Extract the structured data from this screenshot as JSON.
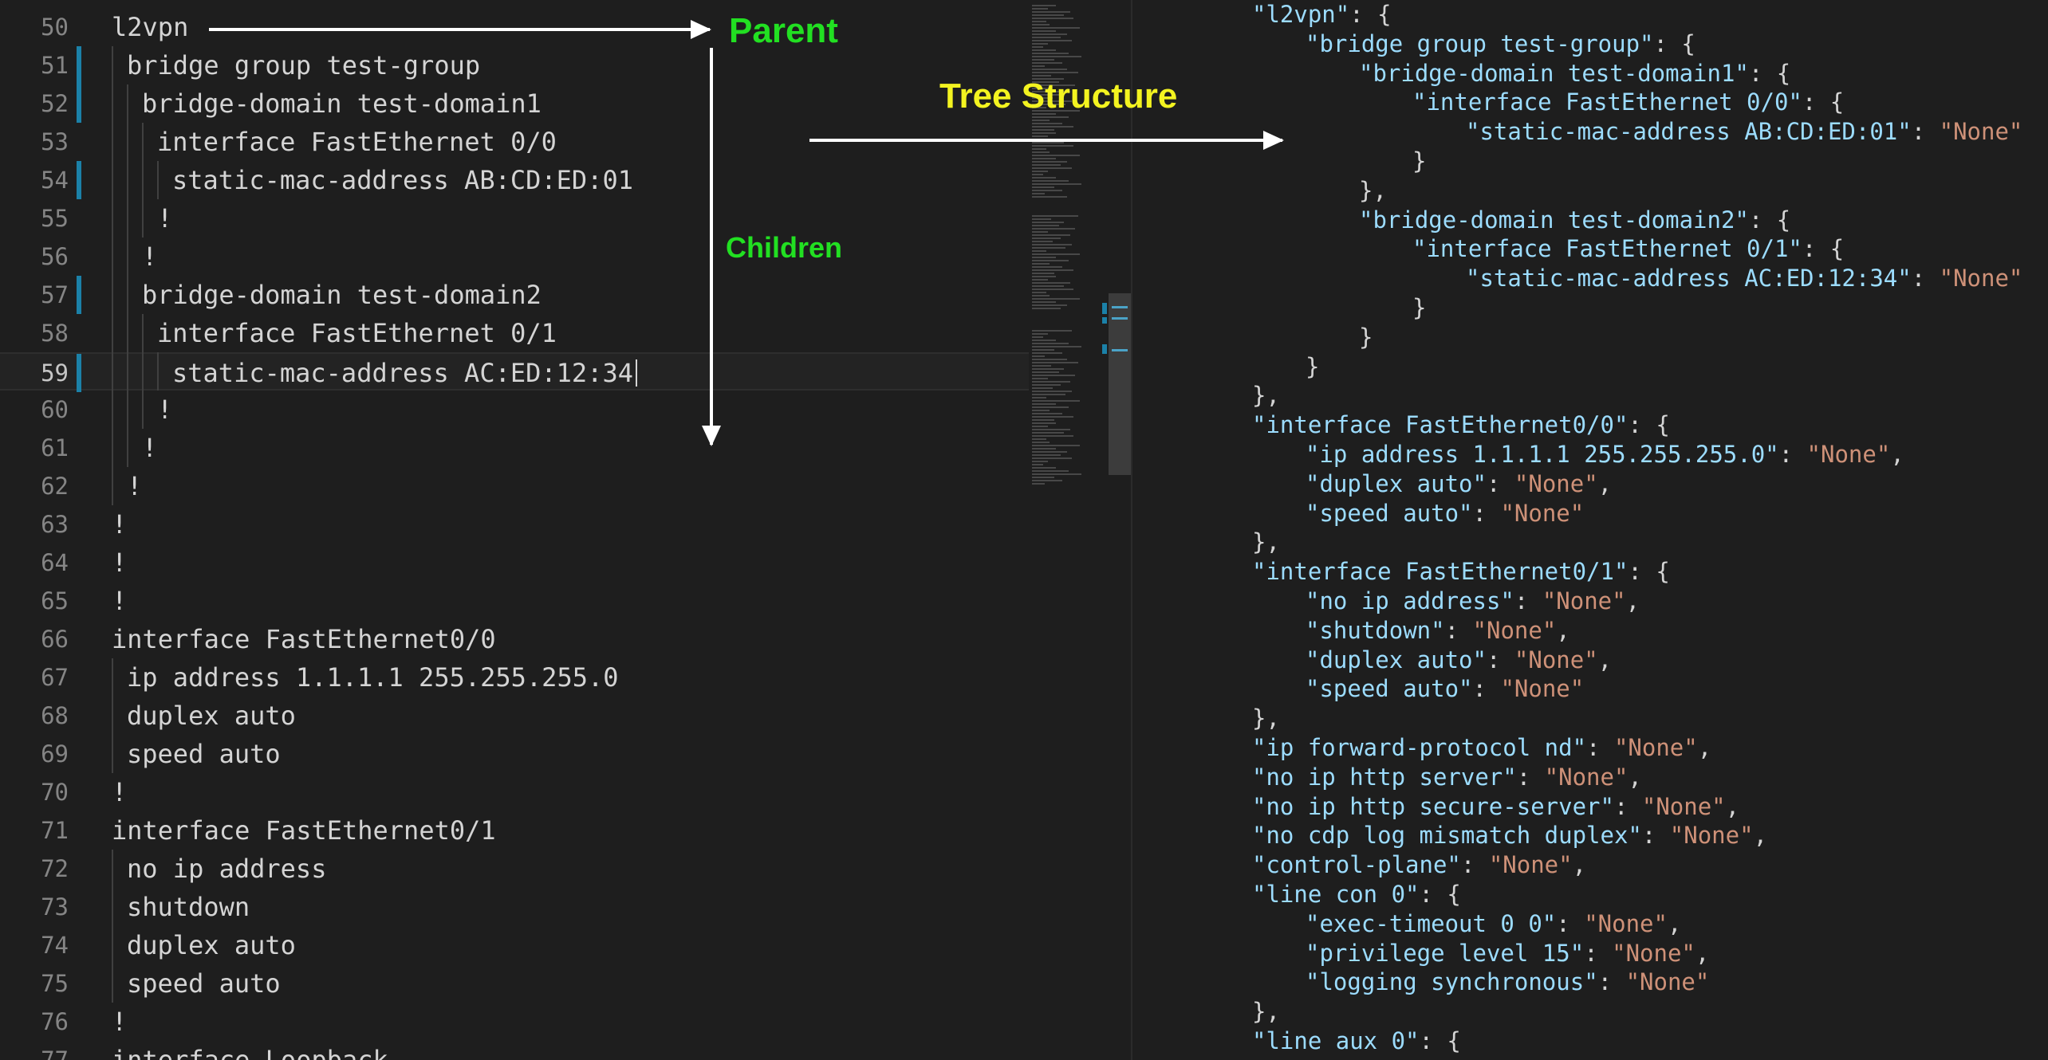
{
  "editor": {
    "lines": [
      {
        "num": "50",
        "text": "l2vpn",
        "indent": 0,
        "mark": false
      },
      {
        "num": "51",
        "text": "bridge group test-group",
        "indent": 1,
        "mark": true
      },
      {
        "num": "52",
        "text": "bridge-domain test-domain1",
        "indent": 2,
        "mark": true
      },
      {
        "num": "53",
        "text": "interface FastEthernet 0/0",
        "indent": 3,
        "mark": false
      },
      {
        "num": "54",
        "text": "static-mac-address AB:CD:ED:01",
        "indent": 4,
        "mark": true
      },
      {
        "num": "55",
        "text": "!",
        "indent": 3,
        "mark": false
      },
      {
        "num": "56",
        "text": "!",
        "indent": 2,
        "mark": false
      },
      {
        "num": "57",
        "text": "bridge-domain test-domain2",
        "indent": 2,
        "mark": true
      },
      {
        "num": "58",
        "text": "interface FastEthernet 0/1",
        "indent": 3,
        "mark": false
      },
      {
        "num": "59",
        "text": "static-mac-address AC:ED:12:34",
        "indent": 4,
        "mark": true,
        "current": true
      },
      {
        "num": "60",
        "text": "!",
        "indent": 3,
        "mark": false
      },
      {
        "num": "61",
        "text": "!",
        "indent": 2,
        "mark": false
      },
      {
        "num": "62",
        "text": "!",
        "indent": 1,
        "mark": false
      },
      {
        "num": "63",
        "text": "!",
        "indent": 0,
        "mark": false
      },
      {
        "num": "64",
        "text": "!",
        "indent": 0,
        "mark": false
      },
      {
        "num": "65",
        "text": "!",
        "indent": 0,
        "mark": false
      },
      {
        "num": "66",
        "text": "interface FastEthernet0/0",
        "indent": 0,
        "mark": false
      },
      {
        "num": "67",
        "text": "ip address 1.1.1.1 255.255.255.0",
        "indent": 1,
        "mark": false
      },
      {
        "num": "68",
        "text": "duplex auto",
        "indent": 1,
        "mark": false
      },
      {
        "num": "69",
        "text": "speed auto",
        "indent": 1,
        "mark": false
      },
      {
        "num": "70",
        "text": "!",
        "indent": 0,
        "mark": false
      },
      {
        "num": "71",
        "text": "interface FastEthernet0/1",
        "indent": 0,
        "mark": false
      },
      {
        "num": "72",
        "text": "no ip address",
        "indent": 1,
        "mark": false
      },
      {
        "num": "73",
        "text": "shutdown",
        "indent": 1,
        "mark": false
      },
      {
        "num": "74",
        "text": "duplex auto",
        "indent": 1,
        "mark": false
      },
      {
        "num": "75",
        "text": "speed auto",
        "indent": 1,
        "mark": false
      },
      {
        "num": "76",
        "text": "!",
        "indent": 0,
        "mark": false
      },
      {
        "num": "77",
        "text": "interface Loopback",
        "indent": 0,
        "mark": false
      }
    ]
  },
  "annotations": {
    "parent": "Parent",
    "children": "Children",
    "tree_structure": "Tree Structure",
    "color_green": "#22e022",
    "color_yellow": "#f3f320",
    "color_arrow": "#ffffff"
  },
  "json_view": {
    "lines": [
      {
        "indent": 0,
        "tokens": [
          [
            "k",
            "\"l2vpn\""
          ],
          [
            "p",
            ": {"
          ]
        ]
      },
      {
        "indent": 1,
        "tokens": [
          [
            "k",
            "\"bridge group test-group\""
          ],
          [
            "p",
            ": {"
          ]
        ]
      },
      {
        "indent": 2,
        "tokens": [
          [
            "k",
            "\"bridge-domain test-domain1\""
          ],
          [
            "p",
            ": {"
          ]
        ]
      },
      {
        "indent": 3,
        "tokens": [
          [
            "k",
            "\"interface FastEthernet 0/0\""
          ],
          [
            "p",
            ": {"
          ]
        ]
      },
      {
        "indent": 4,
        "tokens": [
          [
            "k",
            "\"static-mac-address AB:CD:ED:01\""
          ],
          [
            "p",
            ": "
          ],
          [
            "s",
            "\"None\""
          ]
        ]
      },
      {
        "indent": 3,
        "tokens": [
          [
            "p",
            "}"
          ]
        ]
      },
      {
        "indent": 2,
        "tokens": [
          [
            "p",
            "},"
          ]
        ]
      },
      {
        "indent": 2,
        "tokens": [
          [
            "k",
            "\"bridge-domain test-domain2\""
          ],
          [
            "p",
            ": {"
          ]
        ]
      },
      {
        "indent": 3,
        "tokens": [
          [
            "k",
            "\"interface FastEthernet 0/1\""
          ],
          [
            "p",
            ": {"
          ]
        ]
      },
      {
        "indent": 4,
        "tokens": [
          [
            "k",
            "\"static-mac-address AC:ED:12:34\""
          ],
          [
            "p",
            ": "
          ],
          [
            "s",
            "\"None\""
          ]
        ]
      },
      {
        "indent": 3,
        "tokens": [
          [
            "p",
            "}"
          ]
        ]
      },
      {
        "indent": 2,
        "tokens": [
          [
            "p",
            "}"
          ]
        ]
      },
      {
        "indent": 1,
        "tokens": [
          [
            "p",
            "}"
          ]
        ]
      },
      {
        "indent": 0,
        "tokens": [
          [
            "p",
            "},"
          ]
        ]
      },
      {
        "indent": 0,
        "tokens": [
          [
            "k",
            "\"interface FastEthernet0/0\""
          ],
          [
            "p",
            ": {"
          ]
        ]
      },
      {
        "indent": 1,
        "tokens": [
          [
            "k",
            "\"ip address 1.1.1.1 255.255.255.0\""
          ],
          [
            "p",
            ": "
          ],
          [
            "s",
            "\"None\""
          ],
          [
            "p",
            ","
          ]
        ]
      },
      {
        "indent": 1,
        "tokens": [
          [
            "k",
            "\"duplex auto\""
          ],
          [
            "p",
            ": "
          ],
          [
            "s",
            "\"None\""
          ],
          [
            "p",
            ","
          ]
        ]
      },
      {
        "indent": 1,
        "tokens": [
          [
            "k",
            "\"speed auto\""
          ],
          [
            "p",
            ": "
          ],
          [
            "s",
            "\"None\""
          ]
        ]
      },
      {
        "indent": 0,
        "tokens": [
          [
            "p",
            "},"
          ]
        ]
      },
      {
        "indent": 0,
        "tokens": [
          [
            "k",
            "\"interface FastEthernet0/1\""
          ],
          [
            "p",
            ": {"
          ]
        ]
      },
      {
        "indent": 1,
        "tokens": [
          [
            "k",
            "\"no ip address\""
          ],
          [
            "p",
            ": "
          ],
          [
            "s",
            "\"None\""
          ],
          [
            "p",
            ","
          ]
        ]
      },
      {
        "indent": 1,
        "tokens": [
          [
            "k",
            "\"shutdown\""
          ],
          [
            "p",
            ": "
          ],
          [
            "s",
            "\"None\""
          ],
          [
            "p",
            ","
          ]
        ]
      },
      {
        "indent": 1,
        "tokens": [
          [
            "k",
            "\"duplex auto\""
          ],
          [
            "p",
            ": "
          ],
          [
            "s",
            "\"None\""
          ],
          [
            "p",
            ","
          ]
        ]
      },
      {
        "indent": 1,
        "tokens": [
          [
            "k",
            "\"speed auto\""
          ],
          [
            "p",
            ": "
          ],
          [
            "s",
            "\"None\""
          ]
        ]
      },
      {
        "indent": 0,
        "tokens": [
          [
            "p",
            "},"
          ]
        ]
      },
      {
        "indent": 0,
        "tokens": [
          [
            "k",
            "\"ip forward-protocol nd\""
          ],
          [
            "p",
            ": "
          ],
          [
            "s",
            "\"None\""
          ],
          [
            "p",
            ","
          ]
        ]
      },
      {
        "indent": 0,
        "tokens": [
          [
            "k",
            "\"no ip http server\""
          ],
          [
            "p",
            ": "
          ],
          [
            "s",
            "\"None\""
          ],
          [
            "p",
            ","
          ]
        ]
      },
      {
        "indent": 0,
        "tokens": [
          [
            "k",
            "\"no ip http secure-server\""
          ],
          [
            "p",
            ": "
          ],
          [
            "s",
            "\"None\""
          ],
          [
            "p",
            ","
          ]
        ]
      },
      {
        "indent": 0,
        "tokens": [
          [
            "k",
            "\"no cdp log mismatch duplex\""
          ],
          [
            "p",
            ": "
          ],
          [
            "s",
            "\"None\""
          ],
          [
            "p",
            ","
          ]
        ]
      },
      {
        "indent": 0,
        "tokens": [
          [
            "k",
            "\"control-plane\""
          ],
          [
            "p",
            ": "
          ],
          [
            "s",
            "\"None\""
          ],
          [
            "p",
            ","
          ]
        ]
      },
      {
        "indent": 0,
        "tokens": [
          [
            "k",
            "\"line con 0\""
          ],
          [
            "p",
            ": {"
          ]
        ]
      },
      {
        "indent": 1,
        "tokens": [
          [
            "k",
            "\"exec-timeout 0 0\""
          ],
          [
            "p",
            ": "
          ],
          [
            "s",
            "\"None\""
          ],
          [
            "p",
            ","
          ]
        ]
      },
      {
        "indent": 1,
        "tokens": [
          [
            "k",
            "\"privilege level 15\""
          ],
          [
            "p",
            ": "
          ],
          [
            "s",
            "\"None\""
          ],
          [
            "p",
            ","
          ]
        ]
      },
      {
        "indent": 1,
        "tokens": [
          [
            "k",
            "\"logging synchronous\""
          ],
          [
            "p",
            ": "
          ],
          [
            "s",
            "\"None\""
          ]
        ]
      },
      {
        "indent": 0,
        "tokens": [
          [
            "p",
            "},"
          ]
        ]
      },
      {
        "indent": 0,
        "tokens": [
          [
            "k",
            "\"line aux 0\""
          ],
          [
            "p",
            ": {"
          ]
        ]
      }
    ]
  },
  "colors": {
    "editor_bg": "#1e1e1e",
    "line_number": "#858585",
    "code_text": "#d4d4d4",
    "gutter_modified": "#1b81a8",
    "json_key": "#9cdcfe",
    "json_string": "#ce9178"
  }
}
